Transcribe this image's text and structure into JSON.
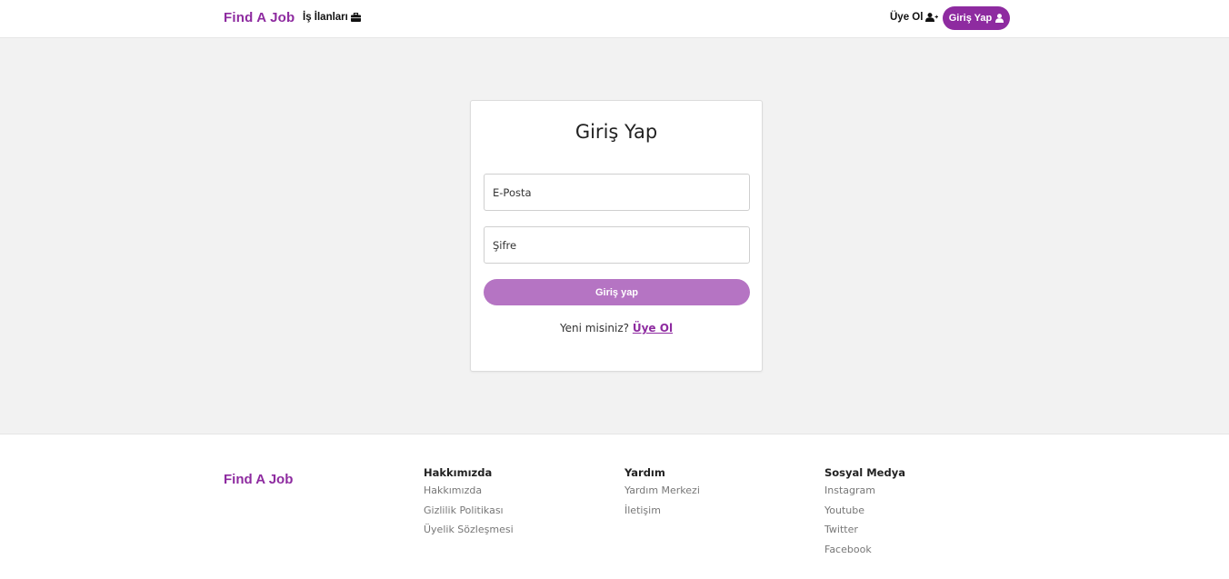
{
  "navbar": {
    "brand": "Find A Job",
    "jobs_label": "İş İlanları",
    "signup_label": "Üye Ol",
    "login_label": "Giriş Yap"
  },
  "login_card": {
    "title": "Giriş Yap",
    "email_placeholder": "E-Posta",
    "password_placeholder": "Şifre",
    "submit_label": "Giriş yap",
    "new_user_text": "Yeni misiniz?",
    "signup_link": "Üye Ol"
  },
  "footer": {
    "brand": "Find A Job",
    "columns": [
      {
        "title": "Hakkımızda",
        "links": [
          "Hakkımızda",
          "Gizlilik Politikası",
          "Üyelik Sözleşmesi"
        ]
      },
      {
        "title": "Yardım",
        "links": [
          "Yardım Merkezi",
          "İletişim"
        ]
      },
      {
        "title": "Sosyal Medya",
        "links": [
          "Instagram",
          "Youtube",
          "Twitter",
          "Facebook"
        ]
      }
    ]
  },
  "colors": {
    "brand": "#8e2ba0",
    "button_light": "#b574c3",
    "background": "#f2f2f2"
  },
  "icons": {
    "jobs": "briefcase-icon",
    "signup": "user-plus-icon",
    "login": "user-icon"
  }
}
